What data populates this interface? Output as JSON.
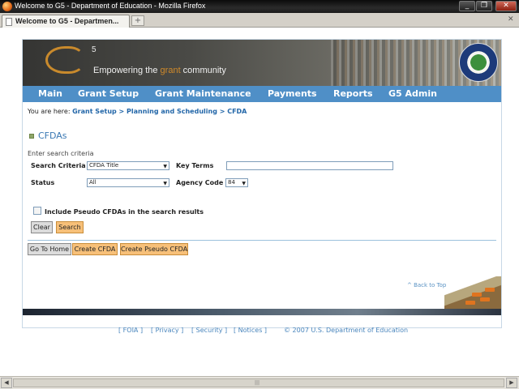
{
  "window": {
    "title": "Welcome to G5 - Department of Education - Mozilla Firefox"
  },
  "browser": {
    "tab_label": "Welcome to G5 - Departmen...",
    "new_tab": "+"
  },
  "banner": {
    "logo_text": "G",
    "logo_sup": "5",
    "tagline_pre": "Empowering the ",
    "tagline_em": "grant",
    "tagline_post": " community"
  },
  "nav": {
    "items": [
      "Main",
      "Grant Setup",
      "Grant Maintenance",
      "Payments",
      "Reports",
      "G5 Admin"
    ]
  },
  "breadcrumb": {
    "prefix": "You are here:",
    "trail": "Grant Setup > Planning and Scheduling > CFDA"
  },
  "section": {
    "title": "CFDAs"
  },
  "form": {
    "instructions": "Enter search criteria",
    "search_criteria_label": "Search Criteria",
    "search_criteria_value": "CFDA Title",
    "key_terms_label": "Key Terms",
    "key_terms_value": "",
    "status_label": "Status",
    "status_value": "All",
    "agency_code_label": "Agency Code",
    "agency_code_value": "84",
    "pseudo_label": "Include Pseudo CFDAs in the search results",
    "clear_label": "Clear",
    "search_label": "Search"
  },
  "actions": {
    "go_home": "Go To Home",
    "create_cfda": "Create CFDA",
    "create_pseudo": "Create Pseudo CFDA"
  },
  "back_to_top": "^ Back to Top",
  "footer": {
    "foia": "[ FOIA ]",
    "privacy": "[ Privacy ]",
    "security": "[ Security ]",
    "notices": "[ Notices ]",
    "copyright": "© 2007 U.S. Department of Education"
  },
  "colors": {
    "nav_bg": "#4f8fc7",
    "link": "#2266a8",
    "accent_button": "#f7c079",
    "logo": "#c98a2c"
  }
}
